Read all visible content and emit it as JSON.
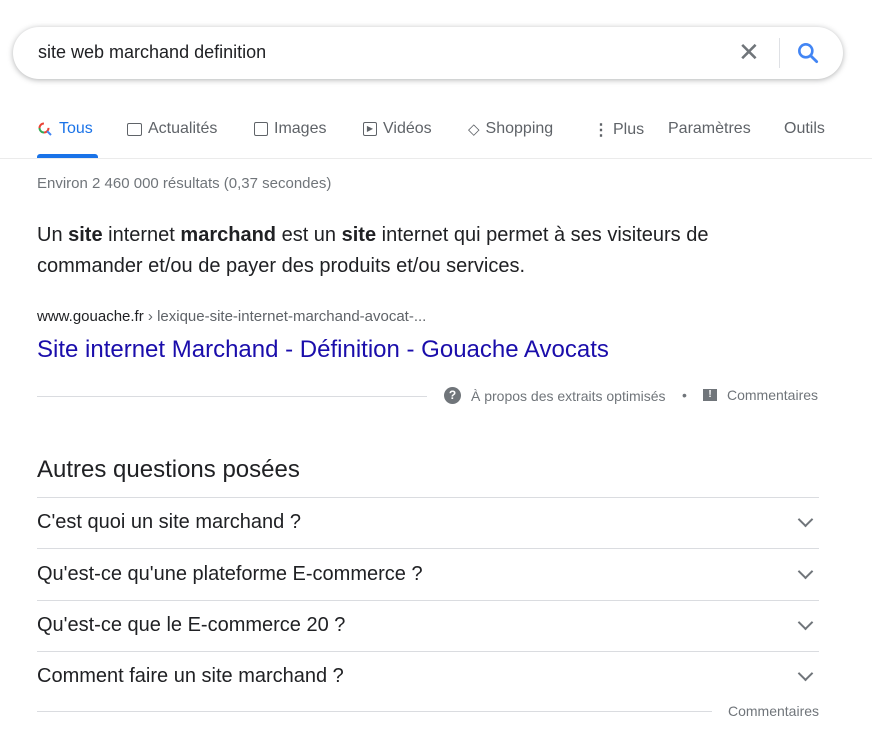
{
  "search": {
    "query": "site web marchand definition"
  },
  "tabs": [
    {
      "label": "Tous",
      "icon": "search-icon",
      "active": true
    },
    {
      "label": "Actualités",
      "icon": "news-icon"
    },
    {
      "label": "Images",
      "icon": "image-icon"
    },
    {
      "label": "Vidéos",
      "icon": "play-icon"
    },
    {
      "label": "Shopping",
      "icon": "tag-icon"
    },
    {
      "label": "Plus",
      "icon": "more-vert-icon"
    },
    {
      "label": "Paramètres"
    },
    {
      "label": "Outils"
    }
  ],
  "stats": "Environ 2 460 000 résultats (0,37 secondes)",
  "snippet": {
    "parts": [
      "Un ",
      "site",
      " internet ",
      "marchand",
      " est un ",
      "site",
      " internet qui permet à ses visiteurs de commander et/ou de payer des produits et/ou services."
    ],
    "url_domain": "www.gouache.fr",
    "url_path": " › lexique-site-internet-marchand-avocat-...",
    "title": "Site internet Marchand - Définition - Gouache Avocats",
    "about": "À propos des extraits optimisés",
    "feedback": "Commentaires"
  },
  "paa": {
    "heading": "Autres questions posées",
    "questions": [
      "C'est quoi un site marchand ?",
      "Qu'est-ce qu'une plateforme E-commerce ?",
      "Qu'est-ce que le E-commerce 20 ?",
      "Comment faire un site marchand ?"
    ],
    "feedback": "Commentaires"
  },
  "colors": {
    "accent": "#1a73e8",
    "link": "#1a0dab"
  }
}
